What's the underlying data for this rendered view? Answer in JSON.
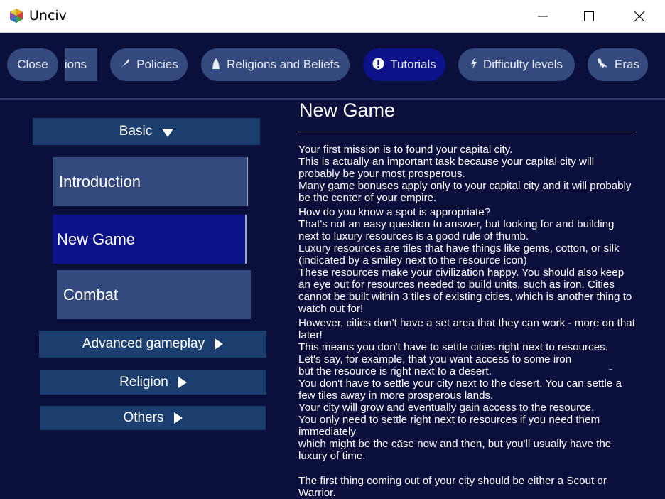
{
  "window": {
    "title": "Unciv"
  },
  "tabs": [
    {
      "label": "Close"
    },
    {
      "label": "ions"
    },
    {
      "label": "Policies",
      "icon": "feather-icon"
    },
    {
      "label": "Religions and Beliefs",
      "icon": "praying-hands-icon"
    },
    {
      "label": "Tutorials",
      "icon": "exclamation-icon",
      "active": true
    },
    {
      "label": "Difficulty levels",
      "icon": "lightning-icon"
    },
    {
      "label": "Eras",
      "icon": "dinosaur-icon"
    }
  ],
  "sidebar": {
    "categories": [
      {
        "label": "Basic",
        "expanded": true
      },
      {
        "label": "Advanced gameplay"
      },
      {
        "label": "Religion"
      },
      {
        "label": "Others"
      }
    ],
    "items": [
      {
        "label": "Introduction"
      },
      {
        "label": "New Game",
        "selected": true
      },
      {
        "label": "Combat"
      }
    ]
  },
  "content": {
    "title": "New Game",
    "paragraphs": [
      "Your first mission is to found your capital city.\nThis is actually an important task because your capital city will probably be your most prosperous.\nMany game bonuses apply only to your capital city and it will probably be the center of your empire.",
      "How do you know a spot is appropriate?\nThat's not an easy question to answer, but looking for and building next to luxury resources is a good rule of thumb.\nLuxury resources are tiles that have things like gems, cotton, or silk (indicated by a smiley next to the resource icon)\nThese resources make your civilization happy. You should also keep an eye out for resources needed to build units, such as iron. Cities cannot be built within 3 tiles of existing cities, which is another thing to watch out for!",
      "However, cities don't have a set area that they can work - more on that later!\nThis means you don't have to settle cities right next to resources.\nLet's say, for example, that you want access to some iron\nbut the resource is right next to a desert.\nYou don't have to settle your city next to the desert. You can settle a few tiles away in more prosperous lands.\nYour city will grow and eventually gain access to the resource.\nYou only need to settle right next to resources if you need them immediately\n   which might be the case now and then, but you'll usually have the luxury of time.",
      "The first thing coming out of your city should be either a Scout or Warrior."
    ]
  },
  "colors": {
    "background": "#0a0f3c",
    "pill": "#34497e",
    "active": "#0c128a",
    "category": "#1b3e6e"
  }
}
